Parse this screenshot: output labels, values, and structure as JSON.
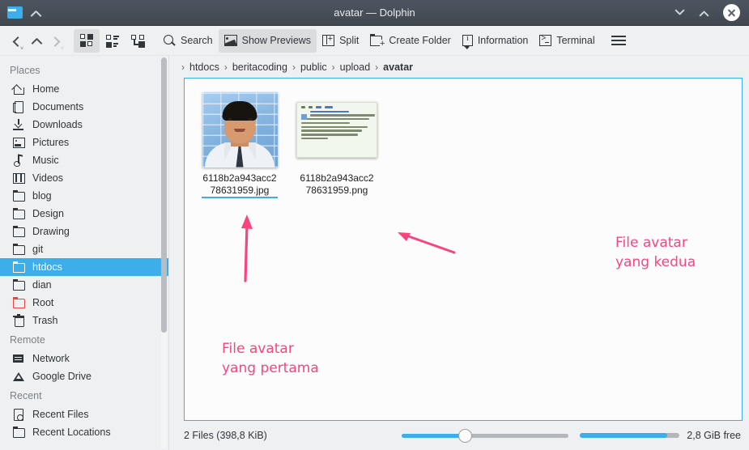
{
  "window": {
    "title": "avatar — Dolphin",
    "app_icon": "folder-icon",
    "collapse_icon": "chevron-up-icon",
    "controls": {
      "minimize": "minimize-icon",
      "maximize": "maximize-icon",
      "close": "close-icon"
    }
  },
  "toolbar": {
    "back": "back-icon",
    "up": "up-icon",
    "forward": "forward-icon",
    "view_icons": "view-icons-icon",
    "view_compact": "view-compact-icon",
    "view_details": "view-details-icon",
    "search_label": "Search",
    "previews_label": "Show Previews",
    "split_label": "Split",
    "create_folder_label": "Create Folder",
    "information_label": "Information",
    "terminal_label": "Terminal",
    "menu": "hamburger-menu-icon"
  },
  "sidebar": {
    "groups": [
      {
        "title": "Places",
        "items": [
          {
            "label": "Home",
            "icon": "home-icon",
            "selected": false
          },
          {
            "label": "Documents",
            "icon": "documents-icon",
            "selected": false
          },
          {
            "label": "Downloads",
            "icon": "downloads-icon",
            "selected": false
          },
          {
            "label": "Pictures",
            "icon": "pictures-icon",
            "selected": false
          },
          {
            "label": "Music",
            "icon": "music-icon",
            "selected": false
          },
          {
            "label": "Videos",
            "icon": "videos-icon",
            "selected": false
          },
          {
            "label": "blog",
            "icon": "folder-icon",
            "selected": false
          },
          {
            "label": "Design",
            "icon": "folder-icon",
            "selected": false
          },
          {
            "label": "Drawing",
            "icon": "folder-icon",
            "selected": false
          },
          {
            "label": "git",
            "icon": "folder-icon",
            "selected": false
          },
          {
            "label": "htdocs",
            "icon": "folder-icon",
            "selected": true
          },
          {
            "label": "dian",
            "icon": "folder-icon",
            "selected": false
          },
          {
            "label": "Root",
            "icon": "folder-red-icon",
            "selected": false
          },
          {
            "label": "Trash",
            "icon": "trash-icon",
            "selected": false
          }
        ]
      },
      {
        "title": "Remote",
        "items": [
          {
            "label": "Network",
            "icon": "network-icon",
            "selected": false
          },
          {
            "label": "Google Drive",
            "icon": "google-drive-icon",
            "selected": false
          }
        ]
      },
      {
        "title": "Recent",
        "items": [
          {
            "label": "Recent Files",
            "icon": "recent-files-icon",
            "selected": false
          },
          {
            "label": "Recent Locations",
            "icon": "recent-locations-icon",
            "selected": false
          }
        ]
      }
    ]
  },
  "breadcrumb": {
    "separator": "›",
    "crumbs": [
      "htdocs",
      "beritacoding",
      "public",
      "upload",
      "avatar"
    ],
    "current": "avatar"
  },
  "files": [
    {
      "name": "6118b2a943acc278631959.jpg",
      "line1": "6118b2a943acc2",
      "line2": "78631959.jpg",
      "type": "image-photo",
      "hovered": true
    },
    {
      "name": "6118b2a943acc278631959.png",
      "line1": "6118b2a943acc2",
      "line2": "78631959.png",
      "type": "image-screenshot",
      "hovered": false
    }
  ],
  "annotations": [
    {
      "text_line1": "File avatar",
      "text_line2": "yang kedua",
      "color": "#f9447e",
      "arrow": "arrow-left"
    },
    {
      "text_line1": "File avatar",
      "text_line2": "yang pertama",
      "color": "#f9447e",
      "arrow": "arrow-up"
    }
  ],
  "statusbar": {
    "files_text": "2 Files (398,8 KiB)",
    "free_text": "2,8 GiB free",
    "zoom_value": 36,
    "capacity_value": 88
  },
  "colors": {
    "accent": "#3daee9",
    "titlebar": "#4a525c",
    "annotation": "#f9447e",
    "chrome": "#eff0f1"
  }
}
